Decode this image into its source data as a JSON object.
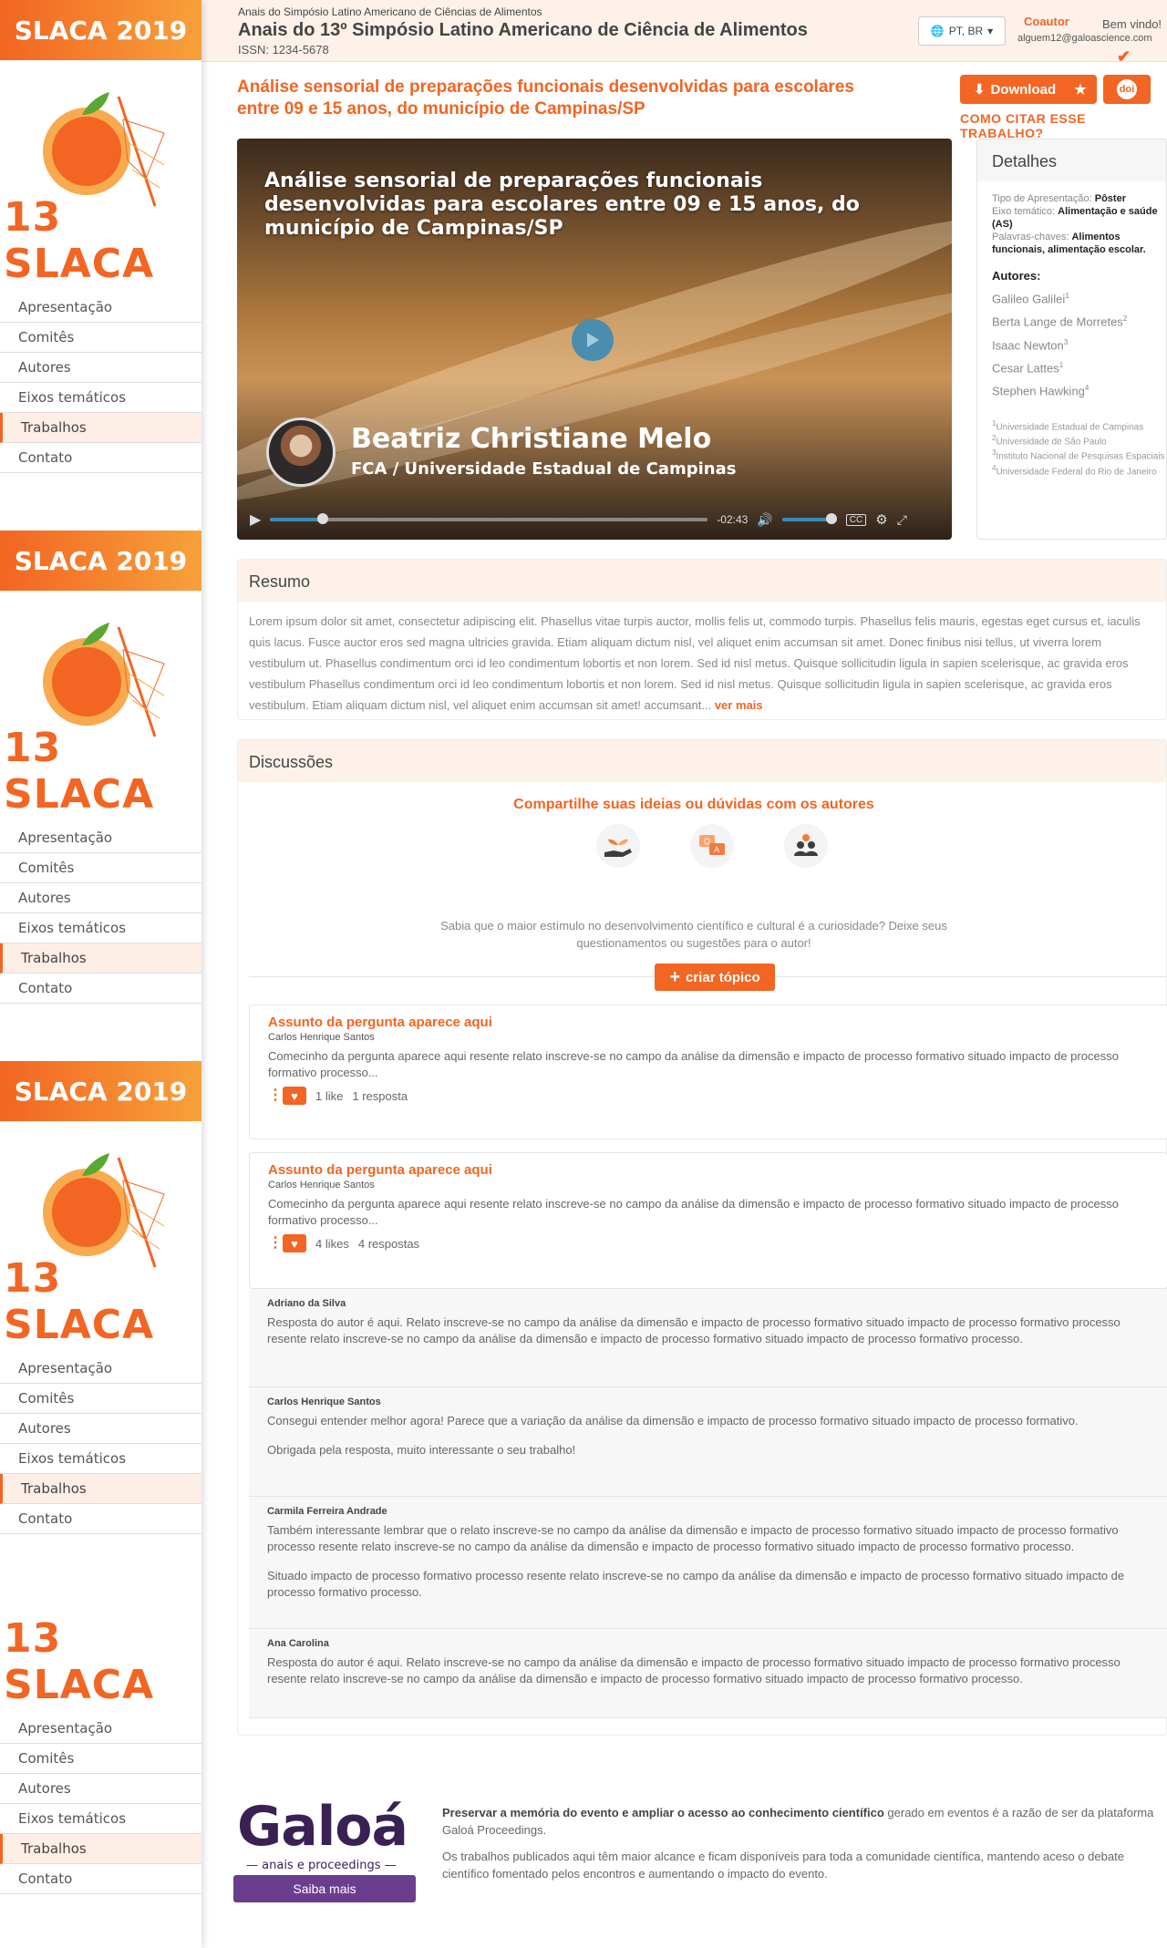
{
  "sidebar": {
    "brand": "SLACA 2019",
    "logo_text": "13 SLACA",
    "nav": [
      "Apresentação",
      "Comitês",
      "Autores",
      "Eixos temáticos",
      "Trabalhos",
      "Contato"
    ],
    "active_index": 4
  },
  "header": {
    "event_small": "Anais do Simpósio Latino Americano de Ciências de Alimentos",
    "event_title": "Anais do 13º Simpósio Latino Americano de Ciência de Alimentos",
    "issn": "ISSN: 1234-5678",
    "language": "PT, BR",
    "coautor": "Coautor",
    "welcome": "Bem vindo!",
    "email": "alguem12@galoascience.com"
  },
  "paper": {
    "title": "Análise sensorial de preparações funcionais desenvolvidas para escolares entre 09 e 15 anos, do município de Campinas/SP",
    "download_label": "Download",
    "doi_label": "doi",
    "cite_label": "COMO CITAR ESSE TRABALHO?"
  },
  "video": {
    "title": "Análise sensorial de preparações funcionais desenvolvidas para escolares entre 09 e 15 anos, do município de Campinas/SP",
    "presenter": "Beatriz Christiane Melo",
    "institution": "FCA / Universidade Estadual de Campinas",
    "time_remaining": "-02:43",
    "progress": 0.12,
    "volume": 0.9
  },
  "details": {
    "heading": "Detalhes",
    "type_label": "Tipo de Apresentação:",
    "type_value": "Pôster",
    "axis_label": "Eixo temático:",
    "axis_value": "Alimentação e saúde (AS)",
    "keywords_label": "Palavras-chaves:",
    "keywords_value": "Alimentos funcionais, alimentação escolar.",
    "authors_heading": "Autores:",
    "authors": [
      {
        "name": "Galileo Galilei",
        "sup": "1"
      },
      {
        "name": "Berta Lange de Morretes",
        "sup": "2"
      },
      {
        "name": "Isaac Newton",
        "sup": "3"
      },
      {
        "name": "Cesar Lattes",
        "sup": "1"
      },
      {
        "name": "Stephen Hawking",
        "sup": "4"
      }
    ],
    "affiliations": [
      {
        "sup": "1",
        "text": "Universidade Estadual de Campinas"
      },
      {
        "sup": "2",
        "text": "Universidade de São Paulo"
      },
      {
        "sup": "3",
        "text": "Instituto Nacional de Pesquisas Espaciais"
      },
      {
        "sup": "4",
        "text": "Universidade Federal do Rio de Janeiro"
      }
    ]
  },
  "resumo": {
    "heading": "Resumo",
    "text": "Lorem ipsum dolor sit amet, consectetur adipiscing elit. Phasellus vitae turpis auctor, mollis felis ut, commodo turpis. Phasellus felis mauris, egestas eget cursus et, iaculis quis lacus. Fusce auctor eros sed magna ultricies gravida. Etiam aliquam dictum nisl, vel aliquet enim accumsan sit amet. Donec finibus nisi tellus, ut viverra lorem vestibulum ut. Phasellus condimentum orci id leo condimentum lobortis et non lorem. Sed id nisl metus. Quisque sollicitudin ligula in sapien scelerisque, ac gravida eros vestibulum Phasellus condimentum orci id leo condimentum lobortis et non lorem. Sed id nisl metus. Quisque sollicitudin ligula in sapien scelerisque, ac gravida eros vestibulum. Etiam aliquam dictum nisl, vel aliquet enim accumsan sit amet! accumsant...",
    "more": " ver mais"
  },
  "discussions": {
    "heading": "Discussões",
    "share": "Compartilhe suas ideias ou dúvidas com os autores",
    "hint": "Sabia que o maior estímulo no desenvolvimento científico e cultural é a curiosidade? Deixe seus questionamentos ou sugestões para o autor!",
    "create_label": "criar tópico",
    "topics": [
      {
        "title": "Assunto da pergunta aparece aqui",
        "author": "Carlos Henrique Santos",
        "text": "Comecinho da pergunta aparece aqui resente relato inscreve-se no campo da análise da dimensão e impacto de processo formativo situado impacto de processo formativo processo...",
        "likes": "1 like",
        "replies": "1 resposta"
      },
      {
        "title": "Assunto da pergunta aparece aqui",
        "author": "Carlos Henrique Santos",
        "text": "Comecinho da pergunta aparece aqui resente relato inscreve-se no campo da análise da dimensão e impacto de processo formativo situado impacto de processo formativo processo...",
        "likes": "4 likes",
        "replies": "4 respostas"
      }
    ],
    "replies": [
      {
        "name": "Adriano da Silva",
        "text": "Resposta do autor é aqui. Relato inscreve-se no campo da análise da dimensão e impacto de processo formativo situado impacto de processo formativo processo resente relato inscreve-se no campo da análise da dimensão e impacto de processo formativo situado impacto de processo formativo processo."
      },
      {
        "name": "Carlos Henrique Santos",
        "text": "Consegui entender melhor agora! Parece que a variação da análise da dimensão e impacto de processo formativo situado impacto de processo formativo.",
        "text2": "Obrigada pela resposta, muito interessante o seu trabalho!"
      },
      {
        "name": "Carmila Ferreira Andrade",
        "text": "Também interessante lembrar que o relato inscreve-se no campo da análise da dimensão e impacto de processo formativo situado impacto de processo formativo processo resente relato inscreve-se no campo da análise da dimensão e impacto de processo formativo situado impacto de processo formativo processo.",
        "text2": "Situado impacto de processo formativo processo resente relato inscreve-se no campo da análise da dimensão e impacto de processo formativo situado impacto de processo formativo processo."
      },
      {
        "name": "Ana Carolina",
        "text": "Resposta do autor é aqui. Relato inscreve-se no campo da análise da dimensão e impacto de processo formativo situado impacto de processo formativo processo resente relato inscreve-se no campo da análise da dimensão e impacto de processo formativo situado impacto de processo formativo processo."
      }
    ]
  },
  "footer": {
    "brand": "Galoá",
    "brand_sub": "anais e proceedings",
    "button": "Saiba mais",
    "bold_text": "Preservar a memória do evento e ampliar o acesso ao conhecimento científico",
    "text1": " gerado em eventos é a razão de ser da plataforma Galoá Proceedings.",
    "text2": "Os trabalhos publicados aqui têm maior alcance e ficam disponíveis para toda a comunidade científica, mantendo aceso o debate científico fomentado pelos encontros e aumentando o impacto do evento."
  },
  "colors": {
    "accent": "#f26522",
    "brand_purple": "#3a2154",
    "button_purple": "#6b3d8f"
  }
}
